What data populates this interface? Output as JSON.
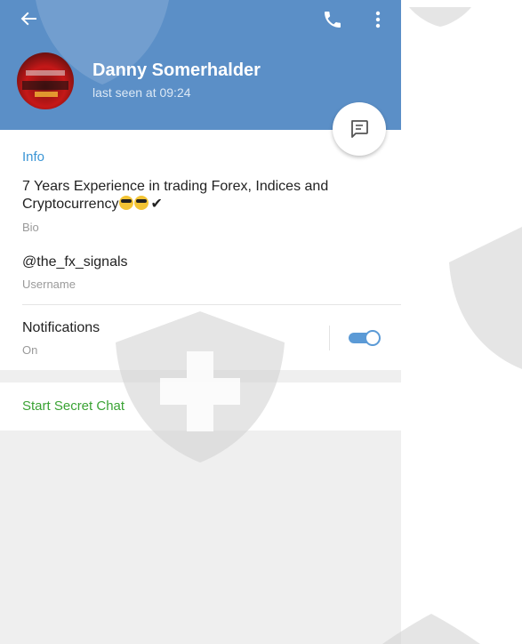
{
  "header": {
    "contact_name": "Danny Somerhalder",
    "status": "last seen at 09:24"
  },
  "info": {
    "section_title": "Info",
    "bio_text": "7 Years Experience in trading Forex, Indices and Cryptocurrency",
    "bio_label": "Bio",
    "username": "@the_fx_signals",
    "username_label": "Username",
    "notifications_label": "Notifications",
    "notifications_value": "On",
    "notifications_enabled": true
  },
  "actions": {
    "secret_chat": "Start Secret Chat"
  },
  "colors": {
    "header": "#5b8fc7",
    "accent_blue": "#3a95d5",
    "green_action": "#3aa334",
    "watermark": "#d9d9d9"
  },
  "icons": [
    "back-arrow-icon",
    "phone-icon",
    "more-vert-icon",
    "message-icon"
  ]
}
